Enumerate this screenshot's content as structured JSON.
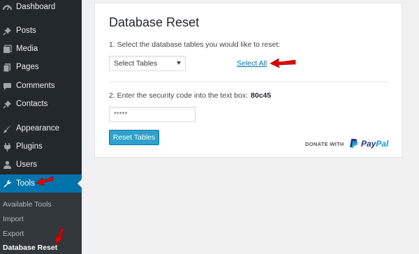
{
  "sidebar": {
    "items": [
      {
        "label": "Dashboard",
        "icon": "dashboard-icon"
      },
      {
        "label": "Posts",
        "icon": "pin-icon"
      },
      {
        "label": "Media",
        "icon": "media-icon"
      },
      {
        "label": "Pages",
        "icon": "pages-icon"
      },
      {
        "label": "Comments",
        "icon": "comment-icon"
      },
      {
        "label": "Contacts",
        "icon": "pin-icon"
      },
      {
        "label": "Appearance",
        "icon": "brush-icon"
      },
      {
        "label": "Plugins",
        "icon": "plug-icon"
      },
      {
        "label": "Users",
        "icon": "user-icon"
      },
      {
        "label": "Tools",
        "icon": "wrench-icon"
      }
    ],
    "submenu": [
      "Available Tools",
      "Import",
      "Export",
      "Database Reset"
    ]
  },
  "panel": {
    "title": "Database Reset",
    "step1": "1. Select the database tables you would like to reset:",
    "select_value": "Select Tables",
    "select_all": "Select All",
    "step2": "2. Enter the security code into the text box:",
    "security_code": "80c45",
    "code_placeholder": "*****",
    "reset_button": "Reset Tables",
    "donate_with": "DONATE WITH",
    "paypal_pay": "Pay",
    "paypal_pal": "Pal"
  },
  "colors": {
    "sidebar_bg": "#23282d",
    "active_bg": "#0073aa",
    "button_bg": "#2ea2cc",
    "arrow": "#e00000"
  }
}
